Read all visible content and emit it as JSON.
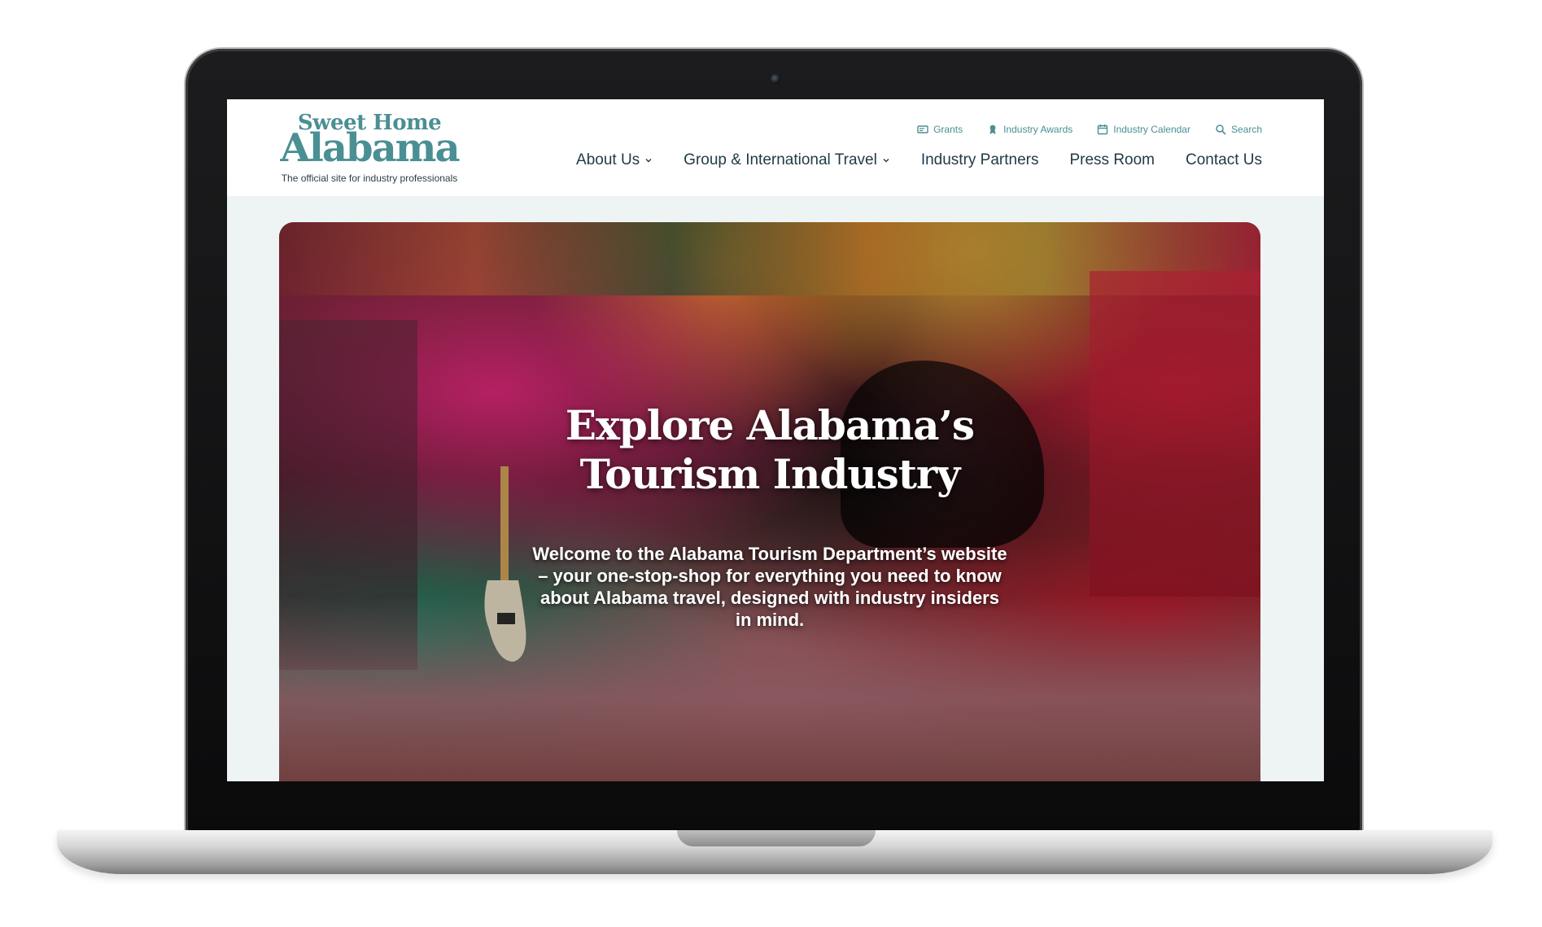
{
  "logo": {
    "top": "Sweet Home",
    "main": "Alabama",
    "tagline": "The official site for industry professionals"
  },
  "utility_nav": [
    {
      "label": "Grants",
      "icon": "grants-icon"
    },
    {
      "label": "Industry Awards",
      "icon": "award-icon"
    },
    {
      "label": "Industry Calendar",
      "icon": "calendar-icon"
    },
    {
      "label": "Search",
      "icon": "search-icon"
    }
  ],
  "main_nav": [
    {
      "label": "About Us",
      "has_dropdown": true
    },
    {
      "label": "Group & International Travel",
      "has_dropdown": true
    },
    {
      "label": "Industry Partners",
      "has_dropdown": false
    },
    {
      "label": "Press Room",
      "has_dropdown": false
    },
    {
      "label": "Contact Us",
      "has_dropdown": false
    }
  ],
  "hero": {
    "title_line1": "Explore Alabama’s",
    "title_line2": "Tourism Industry",
    "subtitle": "Welcome to the Alabama Tourism Department’s website – your one-stop-shop for everything you need to know about Alabama travel, designed with industry insiders in mind."
  },
  "colors": {
    "brand_teal": "#4a8f93",
    "nav_text": "#1f3a46",
    "page_bg": "#eef4f4"
  }
}
